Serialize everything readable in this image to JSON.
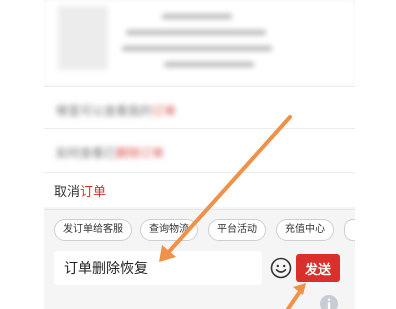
{
  "question_rows": [
    {
      "prefix": "哪里可以查看我的",
      "highlight": "订单"
    },
    {
      "prefix": "如何查看已",
      "highlight": "删除订单"
    }
  ],
  "cancel_row": {
    "prefix": "取消",
    "highlight": "订单"
  },
  "quick_chips": [
    "发订单给客服",
    "查询物流",
    "平台活动",
    "充值中心"
  ],
  "input": {
    "value": "订单删除恢复"
  },
  "send_button": {
    "label": "发送"
  },
  "icons": {
    "emoji": "smiley-icon",
    "info": "info-icon"
  },
  "colors": {
    "accent": "#d9302c",
    "arrow": "#f0914a",
    "background": "#f5f5f5"
  }
}
